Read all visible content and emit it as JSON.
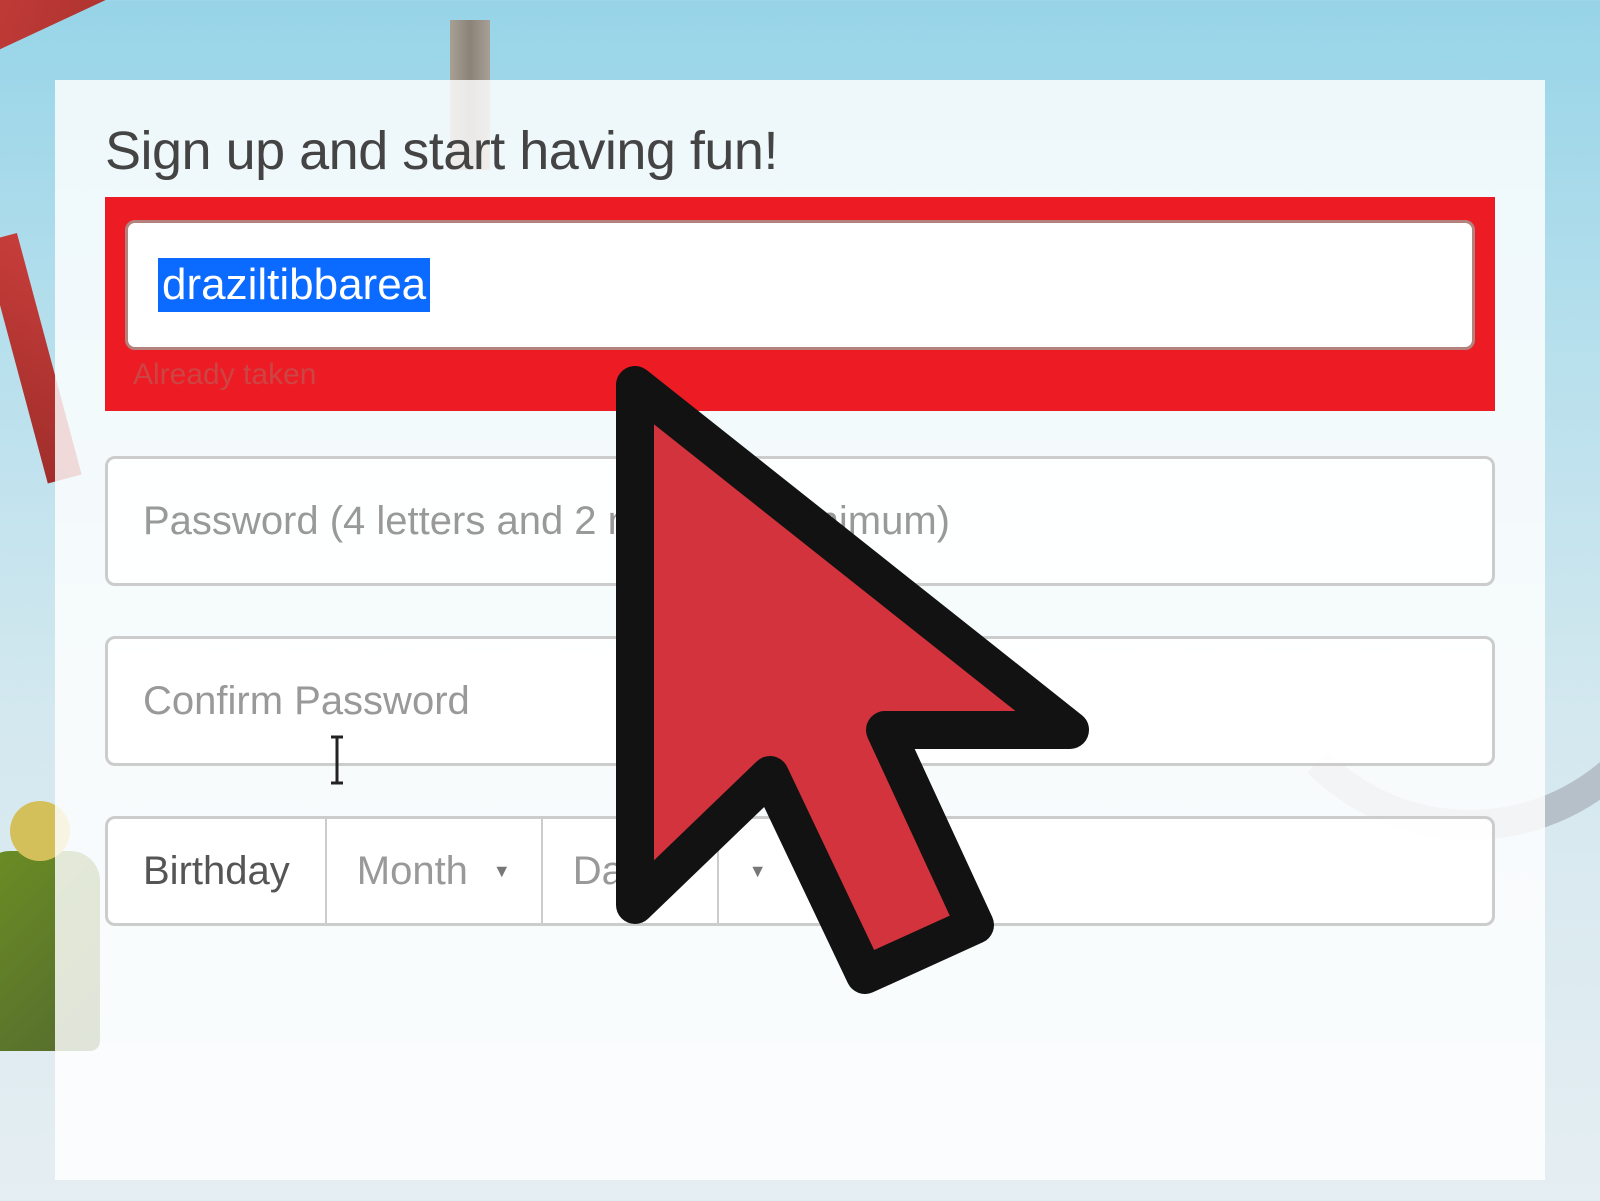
{
  "signup": {
    "title": "Sign up and start having fun!",
    "username_value": "draziltibbarea",
    "username_error": "Already taken",
    "password_placeholder": "Password (4 letters and 2 numbers minimum)",
    "confirm_password_placeholder": "Confirm Password",
    "birthday": {
      "label": "Birthday",
      "month_label": "Month",
      "day_label": "Day"
    }
  },
  "colors": {
    "highlight_box": "#ed1c24",
    "selection_bg": "#0b6aff",
    "cursor_fill": "#d3333d",
    "error_text": "#c44"
  }
}
